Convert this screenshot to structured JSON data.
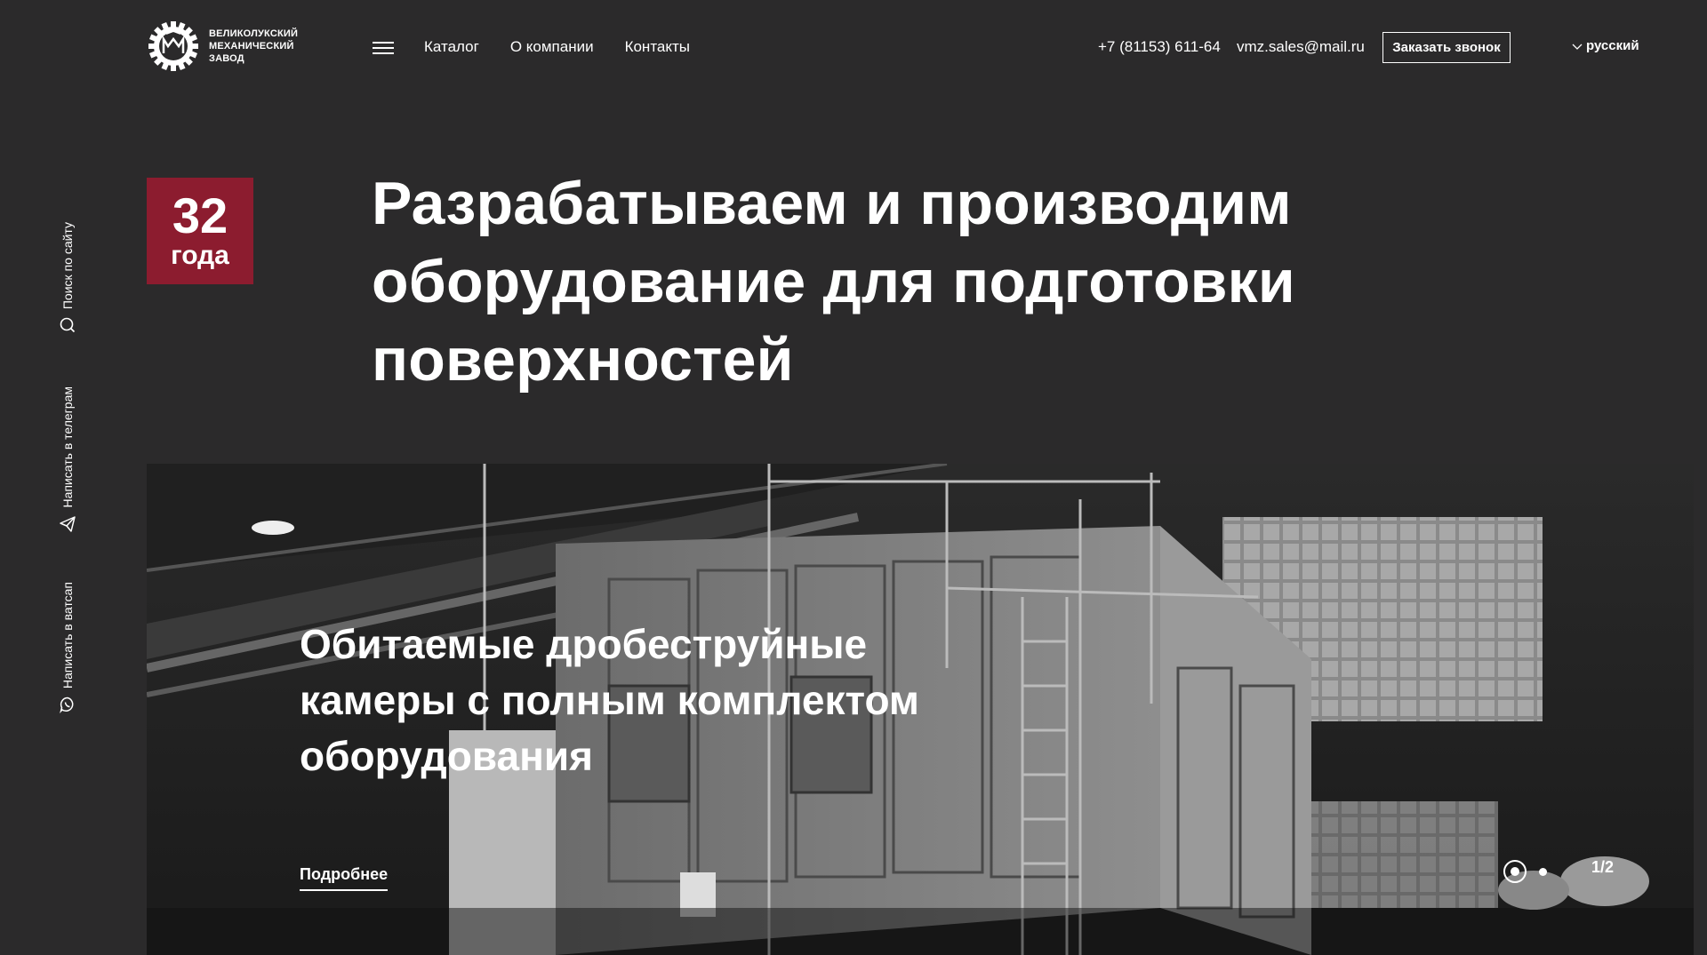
{
  "header": {
    "logo_lines": [
      "ВЕЛИКОЛУКСКИЙ",
      "МЕХАНИЧЕСКИЙ",
      "ЗАВОД"
    ],
    "nav": [
      {
        "label": "Каталог"
      },
      {
        "label": "О компании"
      },
      {
        "label": "Контакты"
      }
    ],
    "phone": "+7 (81153) 611-64",
    "email": "vmz.sales@mail.ru",
    "callback_label": "Заказать звонок",
    "language": "русский"
  },
  "sidebar": {
    "items": [
      {
        "label": "Поиск по сайту",
        "icon": "search-icon"
      },
      {
        "label": "Написать в телеграм",
        "icon": "telegram-icon"
      },
      {
        "label": "Написать в ватсап",
        "icon": "whatsapp-icon"
      }
    ]
  },
  "badge": {
    "number": "32",
    "unit": "года",
    "color": "#8c1c2f"
  },
  "hero": {
    "title": "Разрабатываем и производим оборудование для подготовки поверхностей"
  },
  "slider": {
    "slide_title": "Обитаемые дробеструйные камеры с полным комплектом оборудования",
    "more_label": "Подробнее",
    "counter": "1/2"
  },
  "colors": {
    "background": "#2b2a2b",
    "accent": "#8c1c2f",
    "text": "#ffffff"
  }
}
